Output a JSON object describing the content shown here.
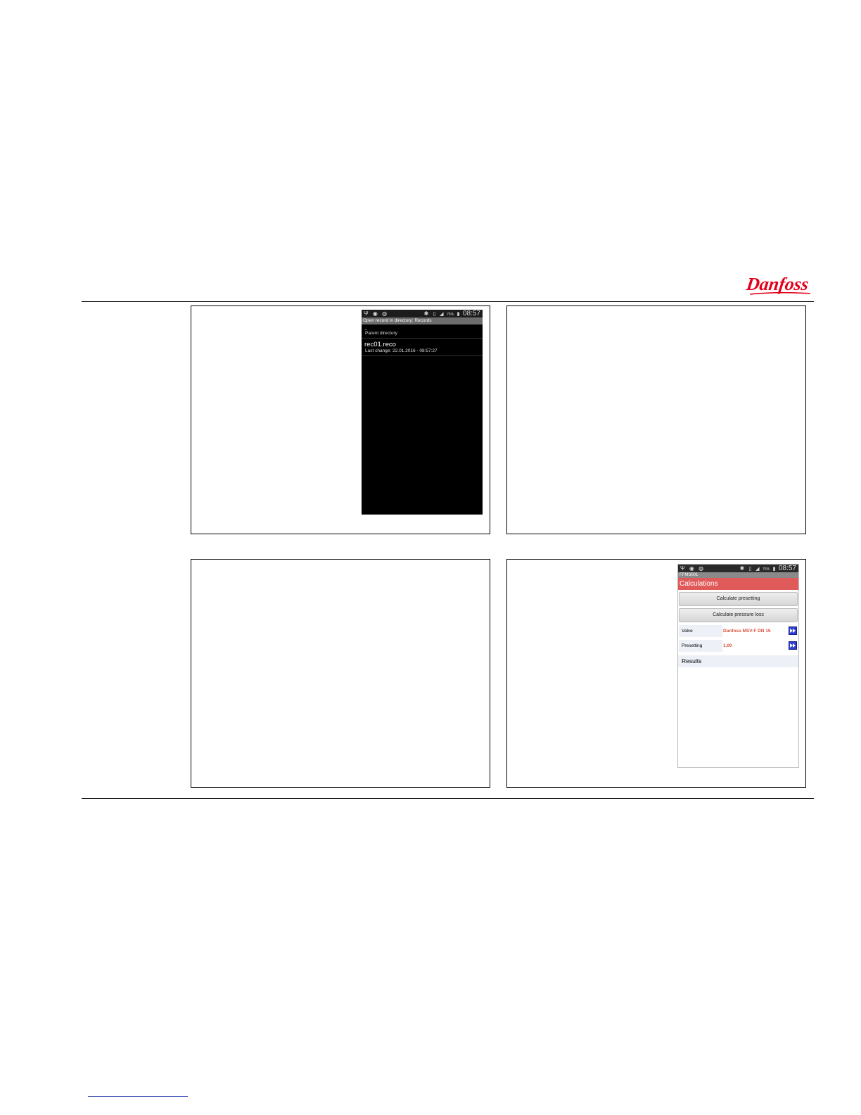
{
  "brand": {
    "logo_text": "Danfoss",
    "logo_color": "#e2001a"
  },
  "screen1": {
    "status": {
      "icons": [
        "usb-icon",
        "sync-icon",
        "gallery-icon"
      ],
      "right_icons": [
        "bluetooth-icon",
        "nfc-icon",
        "signal-icon",
        "battery-icon"
      ],
      "battery": "75%",
      "clock": "08:57"
    },
    "title": "Open record in directory: Records",
    "items": [
      {
        "name": "..",
        "detail": "Parent directory"
      },
      {
        "name": "rec01.reco",
        "detail": "Last change: 22.01.2016 - 08:57:27"
      }
    ]
  },
  "screen2": {
    "status": {
      "battery": "75%",
      "clock": "08:57"
    },
    "device_id": "FFMS001",
    "title": "Calculations",
    "buttons": {
      "calc_presetting": "Calculate presetting",
      "calc_pressure_loss": "Calculate pressure loss"
    },
    "fields": [
      {
        "label": "Valve",
        "value": "Danfoss MSV-F  DN 15"
      },
      {
        "label": "Presetting",
        "value": "1.00"
      }
    ],
    "results_label": "Results",
    "accent_color": "#e15a5a"
  }
}
